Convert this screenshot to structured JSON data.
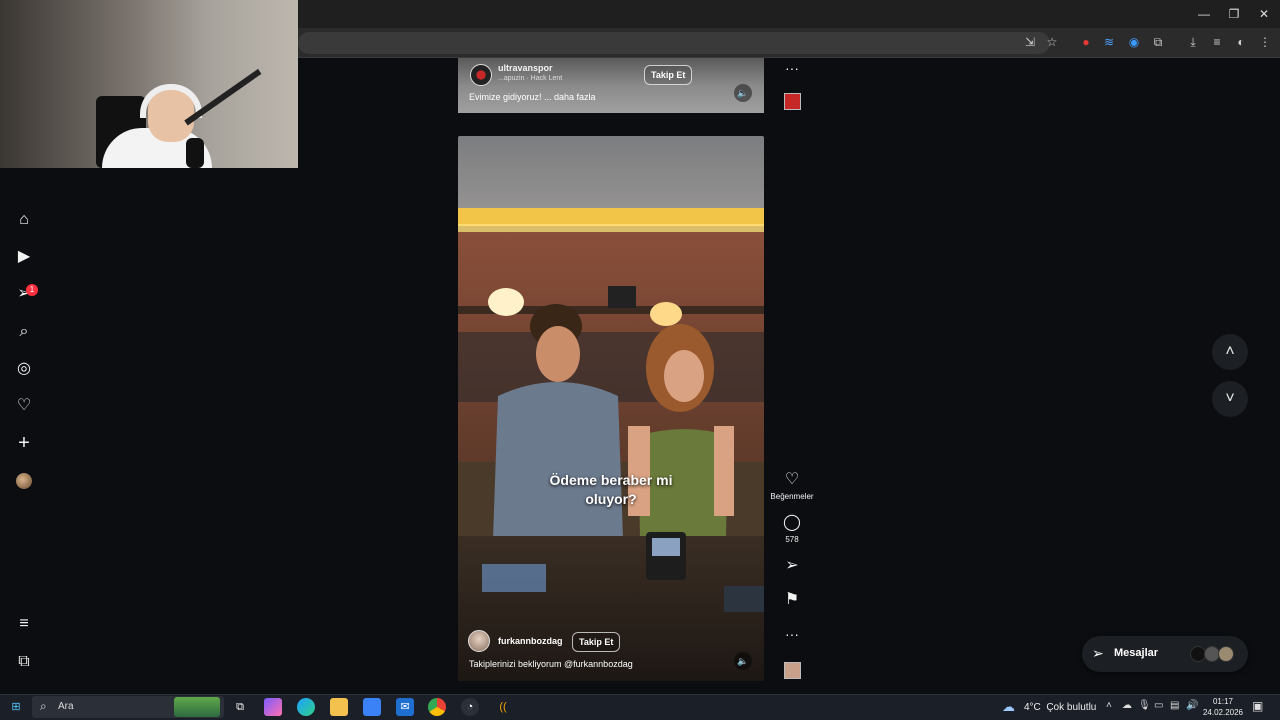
{
  "sidebar": {
    "notification_count": "1"
  },
  "feed": {
    "top_reel": {
      "username": "ultravanspor",
      "audio": "...apuzin · Hack Lent",
      "caption": "Evimize gidiyoruz! ... daha fazla",
      "follow_label": "Takip Et"
    },
    "main_reel": {
      "overlay_line1": "Ödeme beraber mi",
      "overlay_line2": "oluyor?",
      "username": "furkannbozdag",
      "follow_label": "Takip Et",
      "caption": "Takiplerinizi bekliyorum @furkannbozdag"
    },
    "rail": {
      "likes_label": "Beğenmeler",
      "comments_count": "578"
    }
  },
  "messages": {
    "label": "Mesajlar"
  },
  "taskbar": {
    "search_placeholder": "Ara",
    "weather": "4°C  Çok bulutlu",
    "time": "01:17",
    "date": "24.02.2026"
  }
}
